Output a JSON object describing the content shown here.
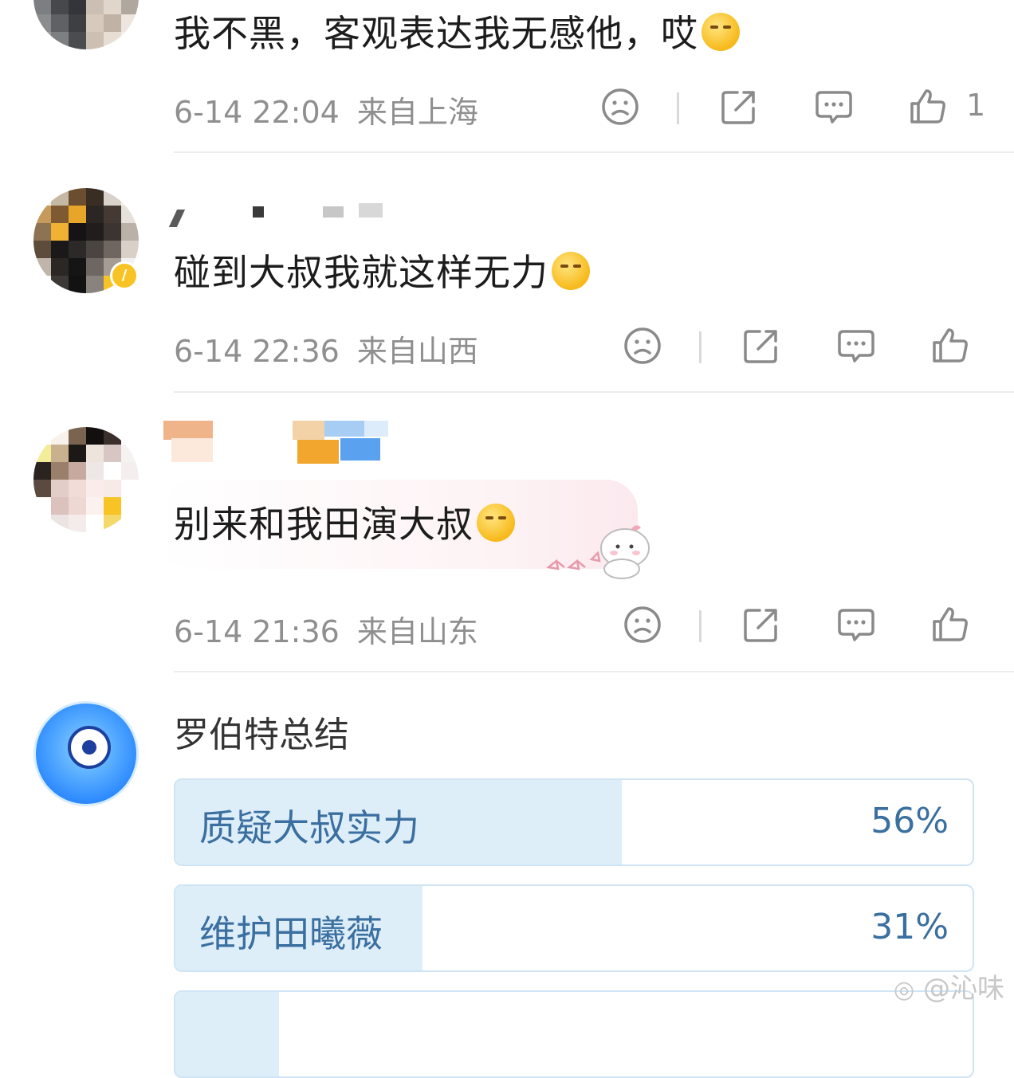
{
  "comments": [
    {
      "text": "我不黑，客观表达我无感他，哎",
      "emoji": "shushing-face-emoji",
      "date": "6-14 22:04",
      "location": "来自上海",
      "like_count": "1"
    },
    {
      "text": "碰到大叔我就这样无力",
      "emoji": "hugging-face-emoji",
      "date": "6-14 22:36",
      "location": "来自山西",
      "like_count": ""
    },
    {
      "text": "别来和我田演大叔",
      "emoji": "face-with-open-eyes-hand-over-mouth-emoji",
      "date": "6-14 21:36",
      "location": "来自山东",
      "like_count": ""
    }
  ],
  "summary": {
    "title": "罗伯特总结",
    "options": [
      {
        "label": "质疑大叔实力",
        "percent": "56%",
        "share": 0.56
      },
      {
        "label": "维护田曦薇",
        "percent": "31%",
        "share": 0.31
      },
      {
        "label": "",
        "percent": "",
        "share": 0.13
      }
    ]
  },
  "watermark": "@沁味",
  "colors": {
    "poll_fill": "#deeef9",
    "poll_text": "#3a6fa0",
    "meta_text": "#8f8f8f",
    "badge": "#f7c325"
  }
}
